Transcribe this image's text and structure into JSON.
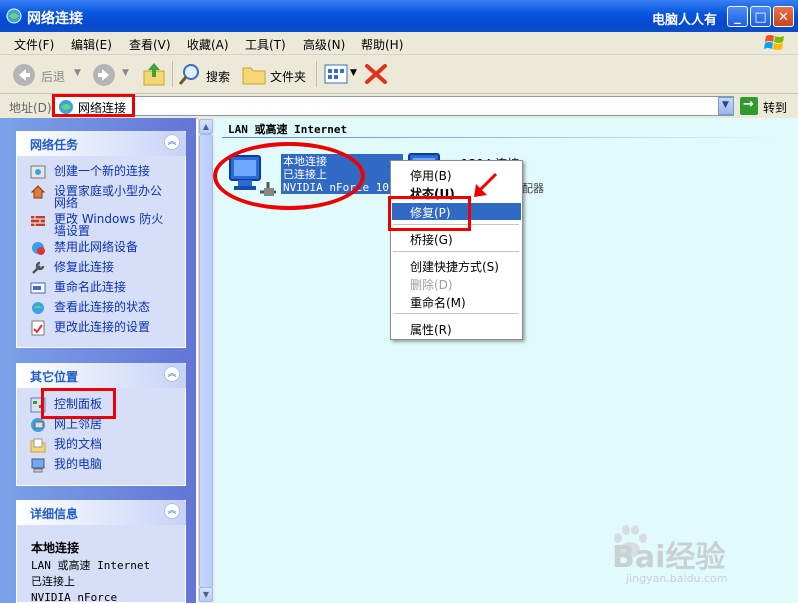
{
  "window": {
    "title": "网络连接",
    "right_text": "电脑人人有"
  },
  "menubar": {
    "items": [
      "文件(F)",
      "编辑(E)",
      "查看(V)",
      "收藏(A)",
      "工具(T)",
      "高级(N)",
      "帮助(H)"
    ]
  },
  "toolbar": {
    "back": "后退",
    "search": "搜索",
    "folders": "文件夹"
  },
  "address": {
    "label": "地址(D)",
    "value": "网络连接",
    "go": "转到"
  },
  "network_tasks": {
    "title": "网络任务",
    "items": [
      "创建一个新的连接",
      "设置家庭或小型办公",
      "网络",
      "更改 Windows 防火",
      "墙设置",
      "禁用此网络设备",
      "修复此连接",
      "重命名此连接",
      "查看此连接的状态",
      "更改此连接的设置"
    ]
  },
  "other_places": {
    "title": "其它位置",
    "items": [
      "控制面板",
      "网上邻居",
      "我的文档",
      "我的电脑"
    ]
  },
  "details": {
    "title": "详细信息",
    "name": "本地连接",
    "lines": [
      "LAN 或高速 Internet",
      "已连接上",
      "NVIDIA nForce"
    ]
  },
  "main": {
    "group_header": "LAN 或高速 Internet",
    "connection": {
      "name": "本地连接",
      "status": "已连接上",
      "device": "NVIDIA nForce 10"
    },
    "other_connection": {
      "name": "1394 连接",
      "fragment": "配器"
    }
  },
  "context_menu": {
    "items": [
      "停用(B)",
      "状态(U)",
      "修复(P)",
      "桥接(G)",
      "创建快捷方式(S)",
      "删除(D)",
      "重命名(M)",
      "属性(R)"
    ],
    "highlighted": "修复(P)"
  },
  "watermark": {
    "brand": "Bai经验",
    "url": "jingyan.baidu.com"
  },
  "colors": {
    "title_blue": "#0a57e0",
    "selection": "#316ac5",
    "annotation_red": "#e00000",
    "main_bg": "#e1fbfc"
  }
}
